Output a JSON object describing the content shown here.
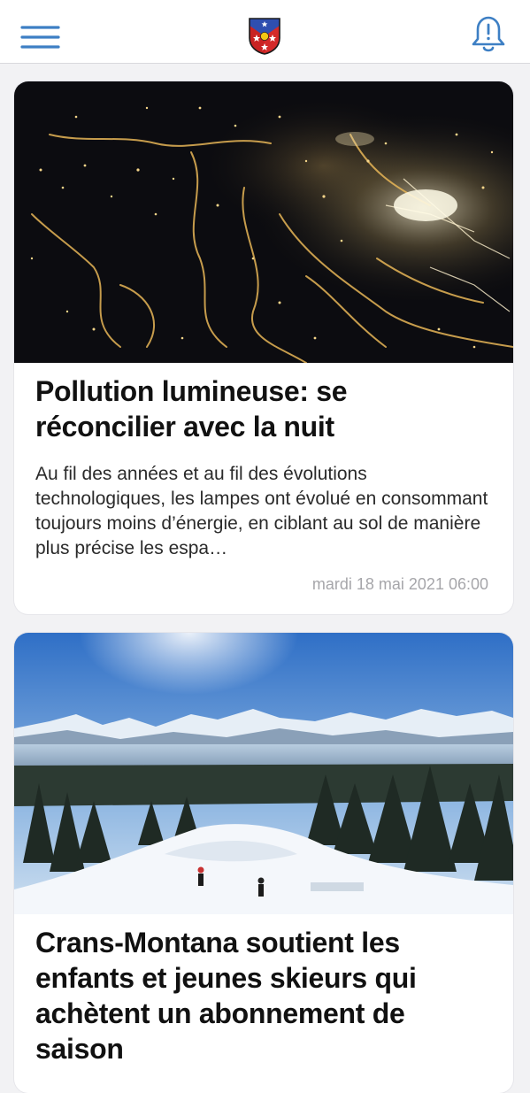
{
  "header": {
    "menu_icon": "hamburger-menu-icon",
    "logo_icon": "crans-montana-crest-icon",
    "notifications_icon": "bell-alert-icon",
    "accent_color": "#3d7fc4"
  },
  "articles": [
    {
      "image_description": "aerial-night-town-lights",
      "title": "Pollution lumineuse: se réconcilier avec la nuit",
      "excerpt": "Au fil des années et au fil des évolutions technologiques, les lampes ont évolué en consommant toujours moins d’énergie, en ciblant au sol de manière plus précise les espa…",
      "date": "mardi 18 mai 2021 06:00"
    },
    {
      "image_description": "ski-slope-mountains",
      "title": "Crans-Montana soutient les enfants et jeunes skieurs qui achètent un abonnement de saison"
    }
  ]
}
